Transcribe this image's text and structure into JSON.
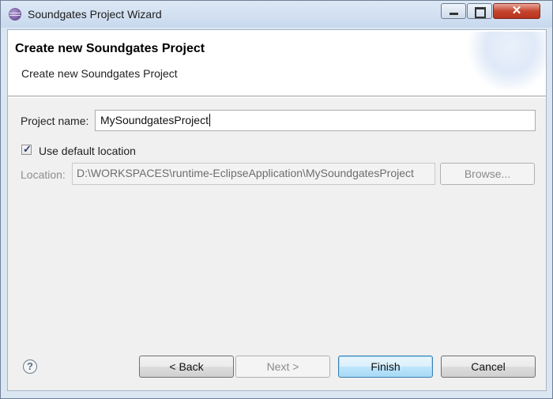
{
  "window": {
    "title": "Soundgates Project Wizard",
    "buttons": {
      "minimize": "minimize",
      "maximize": "maximize",
      "close": "✕"
    }
  },
  "header": {
    "title": "Create new Soundgates Project",
    "description": "Create new Soundgates Project"
  },
  "form": {
    "project_name_label": "Project name:",
    "project_name_value": "MySoundgatesProject",
    "use_default_location_label": "Use default location",
    "use_default_location_checked": true,
    "location_label": "Location:",
    "location_value": "D:\\WORKSPACES\\runtime-EclipseApplication\\MySoundgatesProject",
    "browse_label": "Browse..."
  },
  "footer": {
    "help_glyph": "?",
    "back_label": "< Back",
    "next_label": "Next >",
    "finish_label": "Finish",
    "cancel_label": "Cancel"
  },
  "icons": [
    "eclipse-app-icon",
    "minimize-icon",
    "maximize-icon",
    "close-icon",
    "help-icon",
    "checkmark-icon"
  ]
}
